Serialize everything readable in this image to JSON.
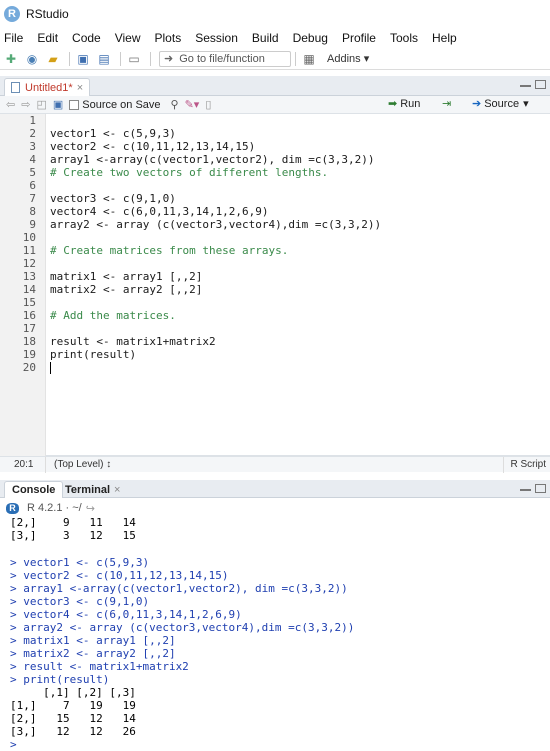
{
  "window": {
    "title": "RStudio"
  },
  "menu": [
    "File",
    "Edit",
    "Code",
    "View",
    "Plots",
    "Session",
    "Build",
    "Debug",
    "Profile",
    "Tools",
    "Help"
  ],
  "toolbar": {
    "goto_placeholder": "Go to file/function",
    "addins_label": "Addins"
  },
  "editor": {
    "tab_label": "Untitled1*",
    "source_on_save_label": "Source on Save",
    "run_label": "Run",
    "source_label": "Source",
    "lines": [
      {
        "num": "1",
        "text": "",
        "type": "code"
      },
      {
        "num": "2",
        "text": "vector1 <- c(5,9,3)",
        "type": "code"
      },
      {
        "num": "3",
        "text": "vector2 <- c(10,11,12,13,14,15)",
        "type": "code"
      },
      {
        "num": "4",
        "text": "array1 <-array(c(vector1,vector2), dim =c(3,3,2))",
        "type": "code"
      },
      {
        "num": "5",
        "text": "# Create two vectors of different lengths.",
        "type": "comment"
      },
      {
        "num": "6",
        "text": "",
        "type": "code"
      },
      {
        "num": "7",
        "text": "vector3 <- c(9,1,0)",
        "type": "code"
      },
      {
        "num": "8",
        "text": "vector4 <- c(6,0,11,3,14,1,2,6,9)",
        "type": "code"
      },
      {
        "num": "9",
        "text": "array2 <- array (c(vector3,vector4),dim =c(3,3,2))",
        "type": "code"
      },
      {
        "num": "10",
        "text": "",
        "type": "code"
      },
      {
        "num": "11",
        "text": "# Create matrices from these arrays.",
        "type": "comment"
      },
      {
        "num": "12",
        "text": "",
        "type": "code"
      },
      {
        "num": "13",
        "text": "matrix1 <- array1 [,,2]",
        "type": "code"
      },
      {
        "num": "14",
        "text": "matrix2 <- array2 [,,2]",
        "type": "code"
      },
      {
        "num": "15",
        "text": "",
        "type": "code"
      },
      {
        "num": "16",
        "text": "# Add the matrices.",
        "type": "comment"
      },
      {
        "num": "17",
        "text": "",
        "type": "code"
      },
      {
        "num": "18",
        "text": "result <- matrix1+matrix2",
        "type": "code"
      },
      {
        "num": "19",
        "text": "print(result)",
        "type": "code"
      },
      {
        "num": "20",
        "text": "",
        "type": "cursor"
      }
    ]
  },
  "statusbar": {
    "position": "20:1",
    "scope": "(Top Level) ↕",
    "language": "R Script"
  },
  "console": {
    "tabs": [
      "Console",
      "Terminal"
    ],
    "r_version": "R 4.2.1 · ~/",
    "lines": [
      {
        "text": "[2,]    9   11   14",
        "type": "out"
      },
      {
        "text": "[3,]    3   12   15",
        "type": "out"
      },
      {
        "text": "",
        "type": "out"
      },
      {
        "text": "> vector1 <- c(5,9,3)",
        "type": "cmd"
      },
      {
        "text": "> vector2 <- c(10,11,12,13,14,15)",
        "type": "cmd"
      },
      {
        "text": "> array1 <-array(c(vector1,vector2), dim =c(3,3,2))",
        "type": "cmd"
      },
      {
        "text": "> vector3 <- c(9,1,0)",
        "type": "cmd"
      },
      {
        "text": "> vector4 <- c(6,0,11,3,14,1,2,6,9)",
        "type": "cmd"
      },
      {
        "text": "> array2 <- array (c(vector3,vector4),dim =c(3,3,2))",
        "type": "cmd"
      },
      {
        "text": "> matrix1 <- array1 [,,2]",
        "type": "cmd"
      },
      {
        "text": "> matrix2 <- array2 [,,2]",
        "type": "cmd"
      },
      {
        "text": "> result <- matrix1+matrix2",
        "type": "cmd"
      },
      {
        "text": "> print(result)",
        "type": "cmd"
      },
      {
        "text": "     [,1] [,2] [,3]",
        "type": "out"
      },
      {
        "text": "[1,]    7   19   19",
        "type": "out"
      },
      {
        "text": "[2,]   15   12   14",
        "type": "out"
      },
      {
        "text": "[3,]   12   12   26",
        "type": "out"
      },
      {
        "text": "> ",
        "type": "cmd"
      }
    ]
  }
}
